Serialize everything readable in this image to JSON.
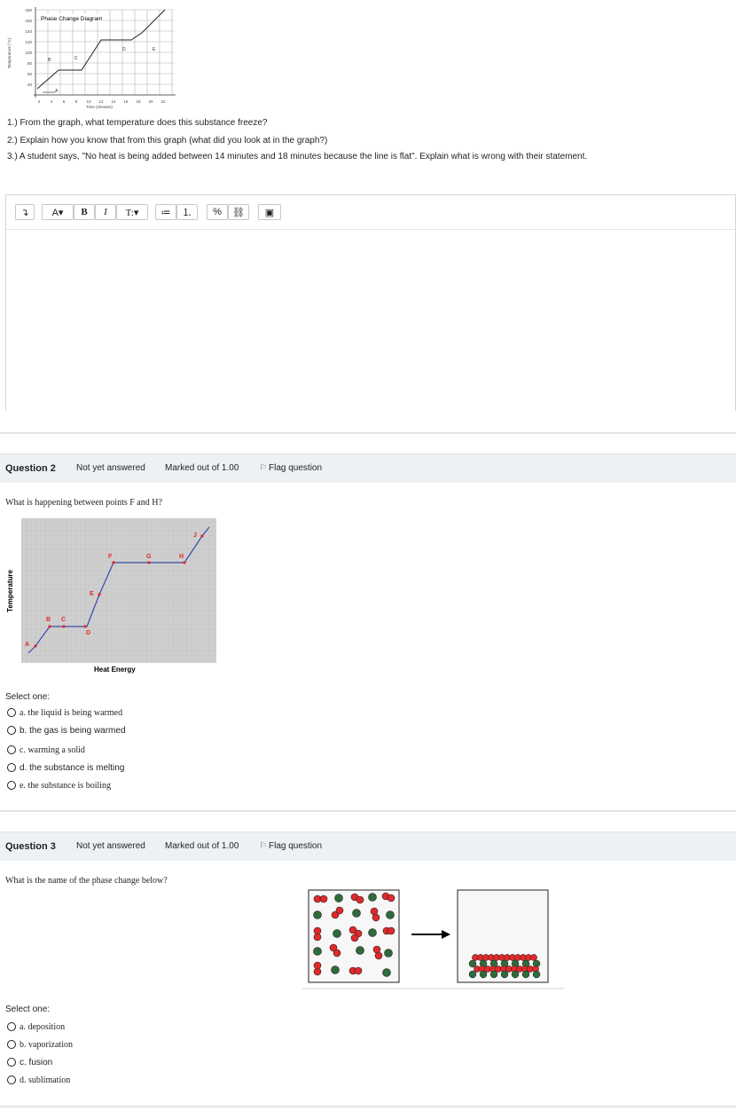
{
  "q1": {
    "graph": {
      "title": "Phase Change Diagram",
      "xlabel": "Time (minutes)",
      "ylabel": "Temperature (°C)",
      "yticks": [
        "180",
        "160",
        "140",
        "120",
        "100",
        "80",
        "60",
        "40"
      ],
      "xticks": [
        "2",
        "4",
        "6",
        "8",
        "10",
        "12",
        "14",
        "16",
        "18",
        "20",
        "22"
      ],
      "points": [
        "A",
        "B",
        "C",
        "D",
        "E"
      ]
    },
    "prompts": [
      "1.) From the graph, what temperature does this substance freeze?",
      "2.) Explain how you know that from this graph (what did you look at in the graph?)",
      "3.) A student says, \"No heat is being added between 14 minutes and 18 minutes because the line is flat\". Explain what is wrong with their statement."
    ]
  },
  "editor": {
    "tools": [
      "↴",
      "A▾",
      "B",
      "I",
      "T:▾",
      "≔",
      "⒈",
      "%",
      "⛓",
      "▣"
    ],
    "text": ""
  },
  "q2": {
    "number": "Question 2",
    "status": "Not yet answered",
    "marks": "Marked out of 1.00",
    "flag": "Flag question",
    "text": "What is happening between points F and H?",
    "graph": {
      "ylabel": "Temperature",
      "xlabel": "Heat Energy",
      "points": [
        "A",
        "B",
        "C",
        "D",
        "E",
        "F",
        "G",
        "H",
        "J"
      ]
    },
    "select_label": "Select one:",
    "options": [
      "a. the liquid is being warmed",
      "b. the gas is being warmed",
      "c. warming a solid",
      "d. the substance is melting",
      "e. the substance is boiling"
    ]
  },
  "q3": {
    "number": "Question 3",
    "status": "Not yet answered",
    "marks": "Marked out of 1.00",
    "flag": "Flag question",
    "text": "What is the name of the phase change below?",
    "select_label": "Select one:",
    "options": [
      "a. deposition",
      "b. vaporization",
      "c. fusion",
      "d. sublimation"
    ]
  },
  "colors": {
    "header_bg": "#eef1f3",
    "red_dot": "#e0292b",
    "green_dot": "#2f6a3b",
    "line_blue": "#3a4aa8"
  }
}
